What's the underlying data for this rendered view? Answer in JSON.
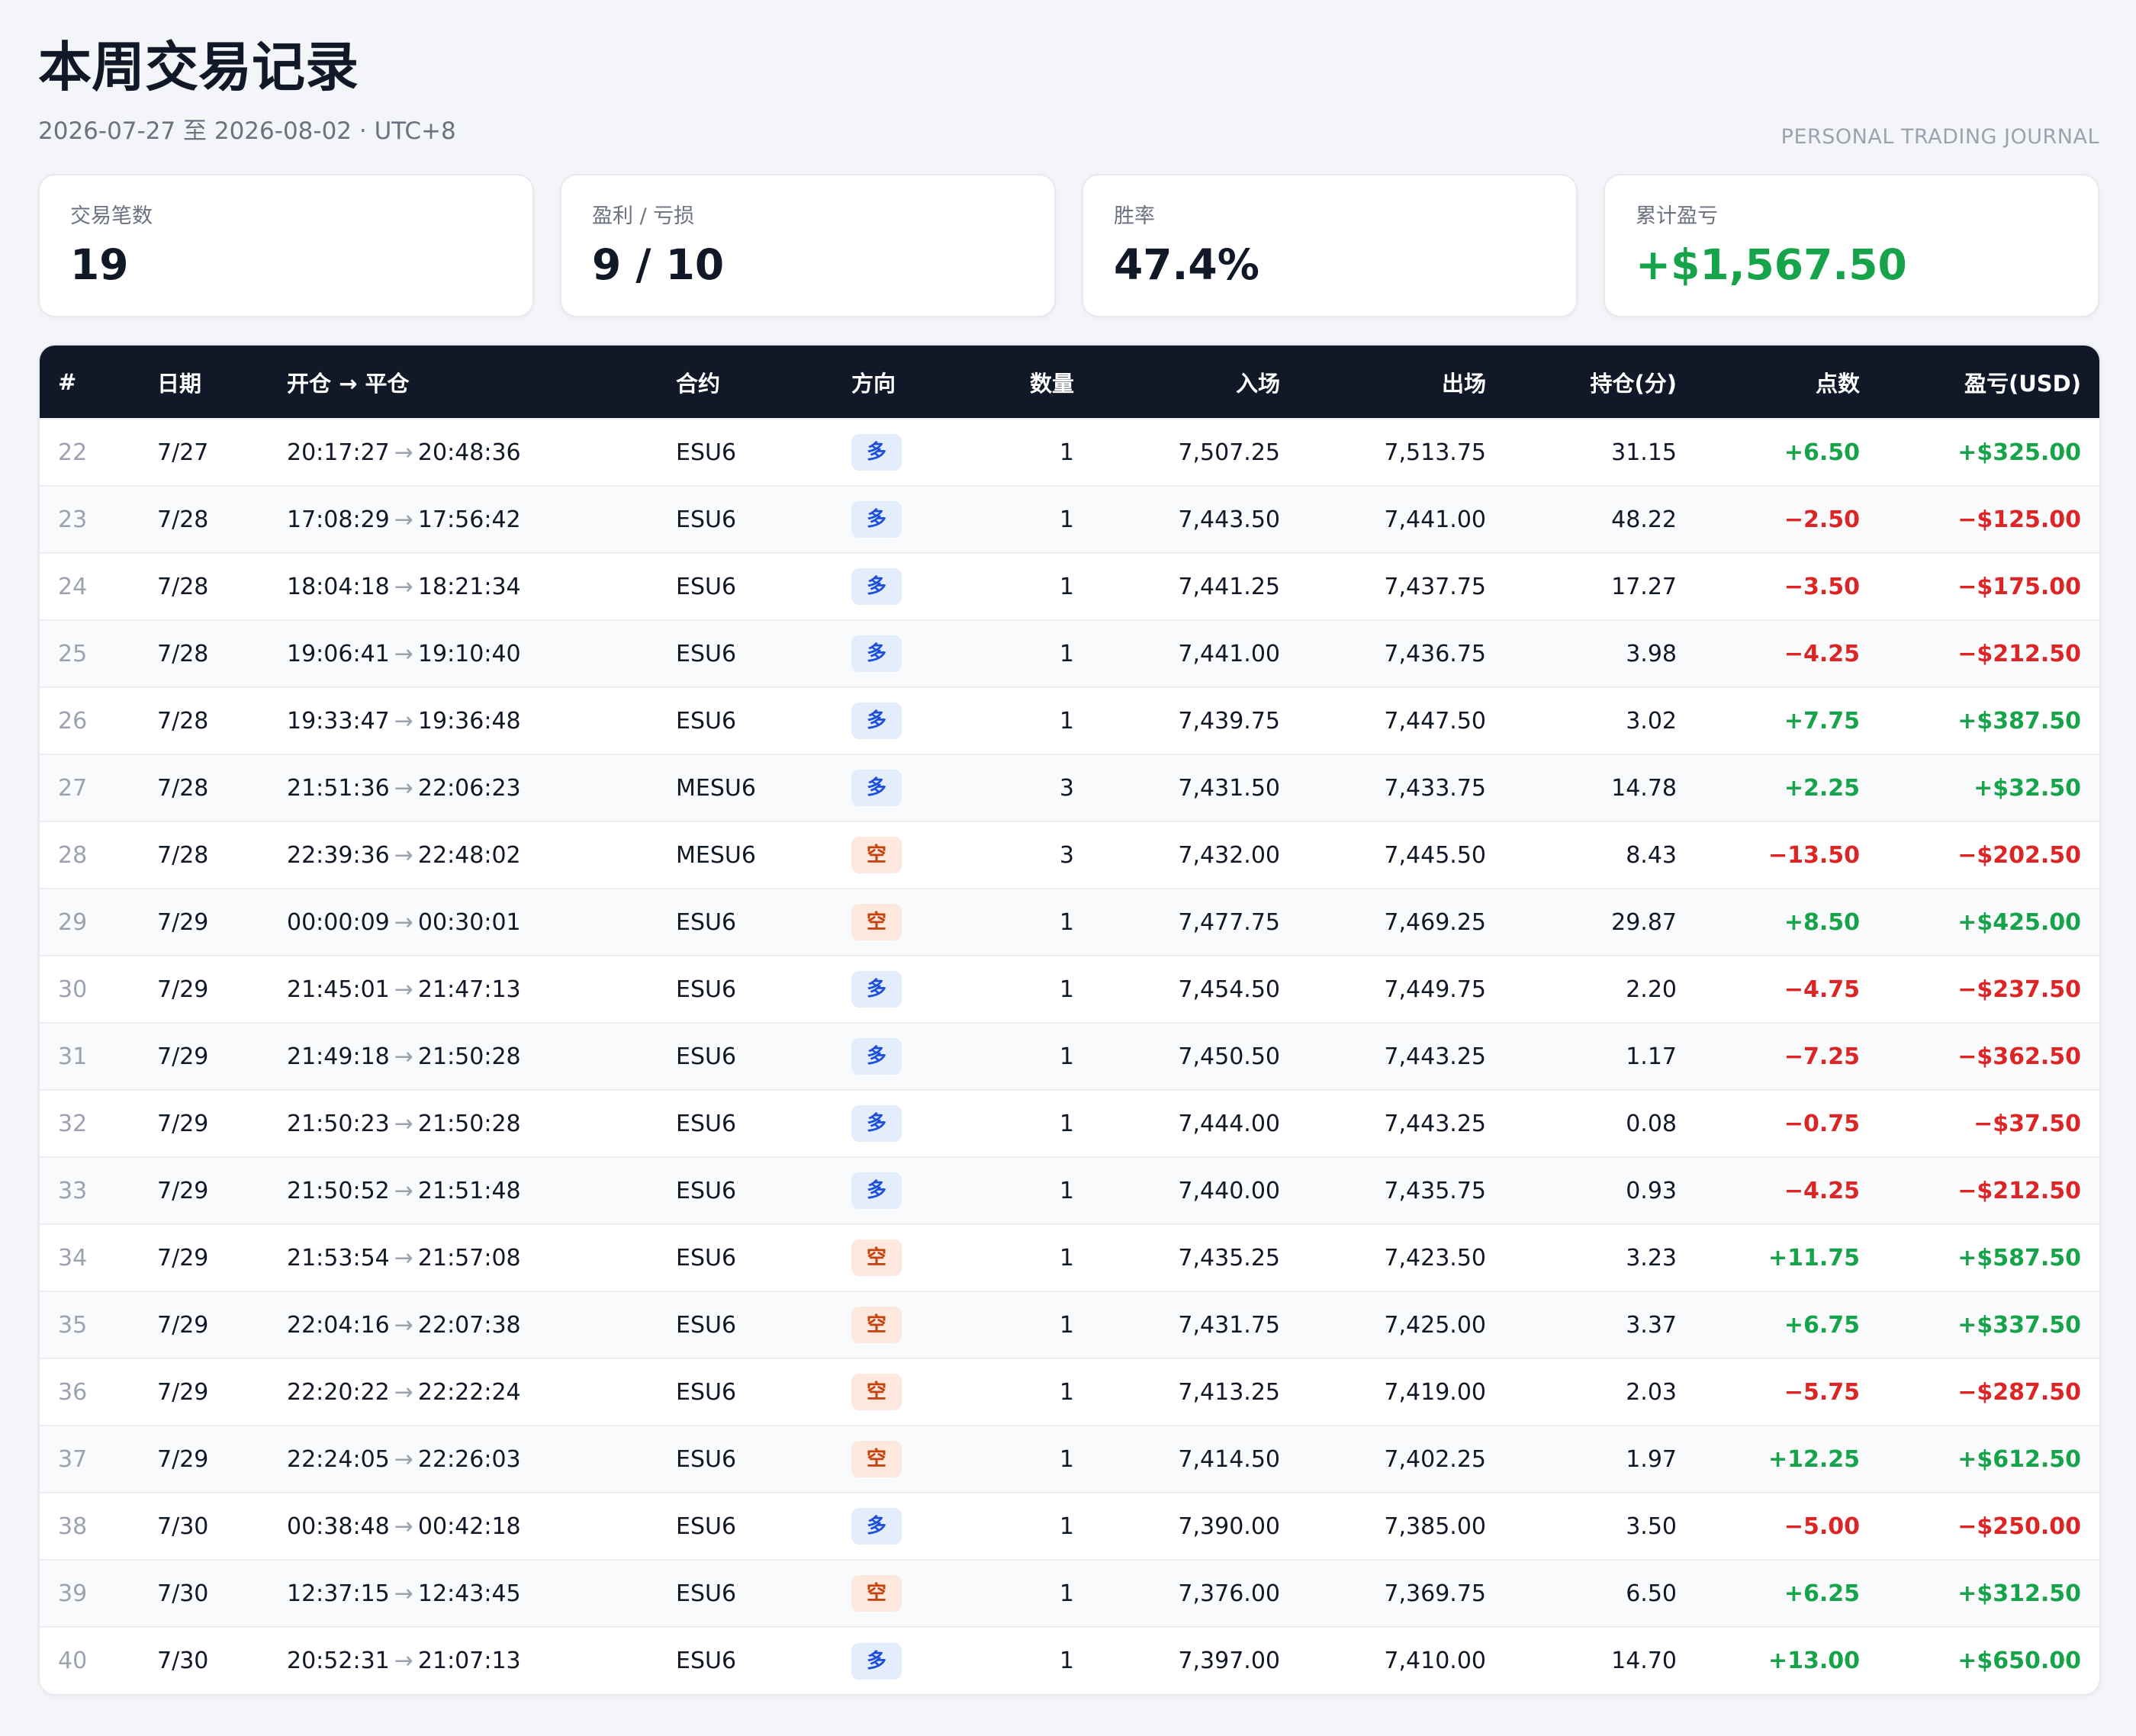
{
  "header": {
    "title": "本周交易记录",
    "subtitle": "2026-07-27 至 2026-08-02 · UTC+8",
    "tag": "PERSONAL TRADING JOURNAL"
  },
  "stats": [
    {
      "label": "交易笔数",
      "value": "19",
      "tone": "neutral"
    },
    {
      "label": "盈利 / 亏损",
      "value": "9 / 10",
      "tone": "neutral"
    },
    {
      "label": "胜率",
      "value": "47.4%",
      "tone": "neutral"
    },
    {
      "label": "累计盈亏",
      "value": "+$1,567.50",
      "tone": "profit"
    }
  ],
  "table": {
    "columns": [
      "#",
      "日期",
      "开仓 → 平仓",
      "合约",
      "方向",
      "数量",
      "入场",
      "出场",
      "持仓(分)",
      "点数",
      "盈亏(USD)"
    ],
    "rows": [
      {
        "id": "22",
        "date": "7/27",
        "open": "20:17:27",
        "close": "20:48:36",
        "contract": "ESU6",
        "side": "多",
        "side_type": "long",
        "qty": "1",
        "entry": "7,507.25",
        "exit": "7,513.75",
        "hold": "31.15",
        "points": "+6.50",
        "pnl": "+$325.00"
      },
      {
        "id": "23",
        "date": "7/28",
        "open": "17:08:29",
        "close": "17:56:42",
        "contract": "ESU6",
        "side": "多",
        "side_type": "long",
        "qty": "1",
        "entry": "7,443.50",
        "exit": "7,441.00",
        "hold": "48.22",
        "points": "−2.50",
        "pnl": "−$125.00"
      },
      {
        "id": "24",
        "date": "7/28",
        "open": "18:04:18",
        "close": "18:21:34",
        "contract": "ESU6",
        "side": "多",
        "side_type": "long",
        "qty": "1",
        "entry": "7,441.25",
        "exit": "7,437.75",
        "hold": "17.27",
        "points": "−3.50",
        "pnl": "−$175.00"
      },
      {
        "id": "25",
        "date": "7/28",
        "open": "19:06:41",
        "close": "19:10:40",
        "contract": "ESU6",
        "side": "多",
        "side_type": "long",
        "qty": "1",
        "entry": "7,441.00",
        "exit": "7,436.75",
        "hold": "3.98",
        "points": "−4.25",
        "pnl": "−$212.50"
      },
      {
        "id": "26",
        "date": "7/28",
        "open": "19:33:47",
        "close": "19:36:48",
        "contract": "ESU6",
        "side": "多",
        "side_type": "long",
        "qty": "1",
        "entry": "7,439.75",
        "exit": "7,447.50",
        "hold": "3.02",
        "points": "+7.75",
        "pnl": "+$387.50"
      },
      {
        "id": "27",
        "date": "7/28",
        "open": "21:51:36",
        "close": "22:06:23",
        "contract": "MESU6",
        "side": "多",
        "side_type": "long",
        "qty": "3",
        "entry": "7,431.50",
        "exit": "7,433.75",
        "hold": "14.78",
        "points": "+2.25",
        "pnl": "+$32.50"
      },
      {
        "id": "28",
        "date": "7/28",
        "open": "22:39:36",
        "close": "22:48:02",
        "contract": "MESU6",
        "side": "空",
        "side_type": "short",
        "qty": "3",
        "entry": "7,432.00",
        "exit": "7,445.50",
        "hold": "8.43",
        "points": "−13.50",
        "pnl": "−$202.50"
      },
      {
        "id": "29",
        "date": "7/29",
        "open": "00:00:09",
        "close": "00:30:01",
        "contract": "ESU6",
        "side": "空",
        "side_type": "short",
        "qty": "1",
        "entry": "7,477.75",
        "exit": "7,469.25",
        "hold": "29.87",
        "points": "+8.50",
        "pnl": "+$425.00"
      },
      {
        "id": "30",
        "date": "7/29",
        "open": "21:45:01",
        "close": "21:47:13",
        "contract": "ESU6",
        "side": "多",
        "side_type": "long",
        "qty": "1",
        "entry": "7,454.50",
        "exit": "7,449.75",
        "hold": "2.20",
        "points": "−4.75",
        "pnl": "−$237.50"
      },
      {
        "id": "31",
        "date": "7/29",
        "open": "21:49:18",
        "close": "21:50:28",
        "contract": "ESU6",
        "side": "多",
        "side_type": "long",
        "qty": "1",
        "entry": "7,450.50",
        "exit": "7,443.25",
        "hold": "1.17",
        "points": "−7.25",
        "pnl": "−$362.50"
      },
      {
        "id": "32",
        "date": "7/29",
        "open": "21:50:23",
        "close": "21:50:28",
        "contract": "ESU6",
        "side": "多",
        "side_type": "long",
        "qty": "1",
        "entry": "7,444.00",
        "exit": "7,443.25",
        "hold": "0.08",
        "points": "−0.75",
        "pnl": "−$37.50"
      },
      {
        "id": "33",
        "date": "7/29",
        "open": "21:50:52",
        "close": "21:51:48",
        "contract": "ESU6",
        "side": "多",
        "side_type": "long",
        "qty": "1",
        "entry": "7,440.00",
        "exit": "7,435.75",
        "hold": "0.93",
        "points": "−4.25",
        "pnl": "−$212.50"
      },
      {
        "id": "34",
        "date": "7/29",
        "open": "21:53:54",
        "close": "21:57:08",
        "contract": "ESU6",
        "side": "空",
        "side_type": "short",
        "qty": "1",
        "entry": "7,435.25",
        "exit": "7,423.50",
        "hold": "3.23",
        "points": "+11.75",
        "pnl": "+$587.50"
      },
      {
        "id": "35",
        "date": "7/29",
        "open": "22:04:16",
        "close": "22:07:38",
        "contract": "ESU6",
        "side": "空",
        "side_type": "short",
        "qty": "1",
        "entry": "7,431.75",
        "exit": "7,425.00",
        "hold": "3.37",
        "points": "+6.75",
        "pnl": "+$337.50"
      },
      {
        "id": "36",
        "date": "7/29",
        "open": "22:20:22",
        "close": "22:22:24",
        "contract": "ESU6",
        "side": "空",
        "side_type": "short",
        "qty": "1",
        "entry": "7,413.25",
        "exit": "7,419.00",
        "hold": "2.03",
        "points": "−5.75",
        "pnl": "−$287.50"
      },
      {
        "id": "37",
        "date": "7/29",
        "open": "22:24:05",
        "close": "22:26:03",
        "contract": "ESU6",
        "side": "空",
        "side_type": "short",
        "qty": "1",
        "entry": "7,414.50",
        "exit": "7,402.25",
        "hold": "1.97",
        "points": "+12.25",
        "pnl": "+$612.50"
      },
      {
        "id": "38",
        "date": "7/30",
        "open": "00:38:48",
        "close": "00:42:18",
        "contract": "ESU6",
        "side": "多",
        "side_type": "long",
        "qty": "1",
        "entry": "7,390.00",
        "exit": "7,385.00",
        "hold": "3.50",
        "points": "−5.00",
        "pnl": "−$250.00"
      },
      {
        "id": "39",
        "date": "7/30",
        "open": "12:37:15",
        "close": "12:43:45",
        "contract": "ESU6",
        "side": "空",
        "side_type": "short",
        "qty": "1",
        "entry": "7,376.00",
        "exit": "7,369.75",
        "hold": "6.50",
        "points": "+6.25",
        "pnl": "+$312.50"
      },
      {
        "id": "40",
        "date": "7/30",
        "open": "20:52:31",
        "close": "21:07:13",
        "contract": "ESU6",
        "side": "多",
        "side_type": "long",
        "qty": "1",
        "entry": "7,397.00",
        "exit": "7,410.00",
        "hold": "14.70",
        "points": "+13.00",
        "pnl": "+$650.00"
      }
    ]
  },
  "colors": {
    "profit": "#16a34a",
    "loss": "#dc2626",
    "header_bg": "#111827",
    "long_badge_bg": "#e3edfc",
    "long_badge_fg": "#1d4ed8",
    "short_badge_bg": "#fde8df",
    "short_badge_fg": "#c2410c"
  }
}
